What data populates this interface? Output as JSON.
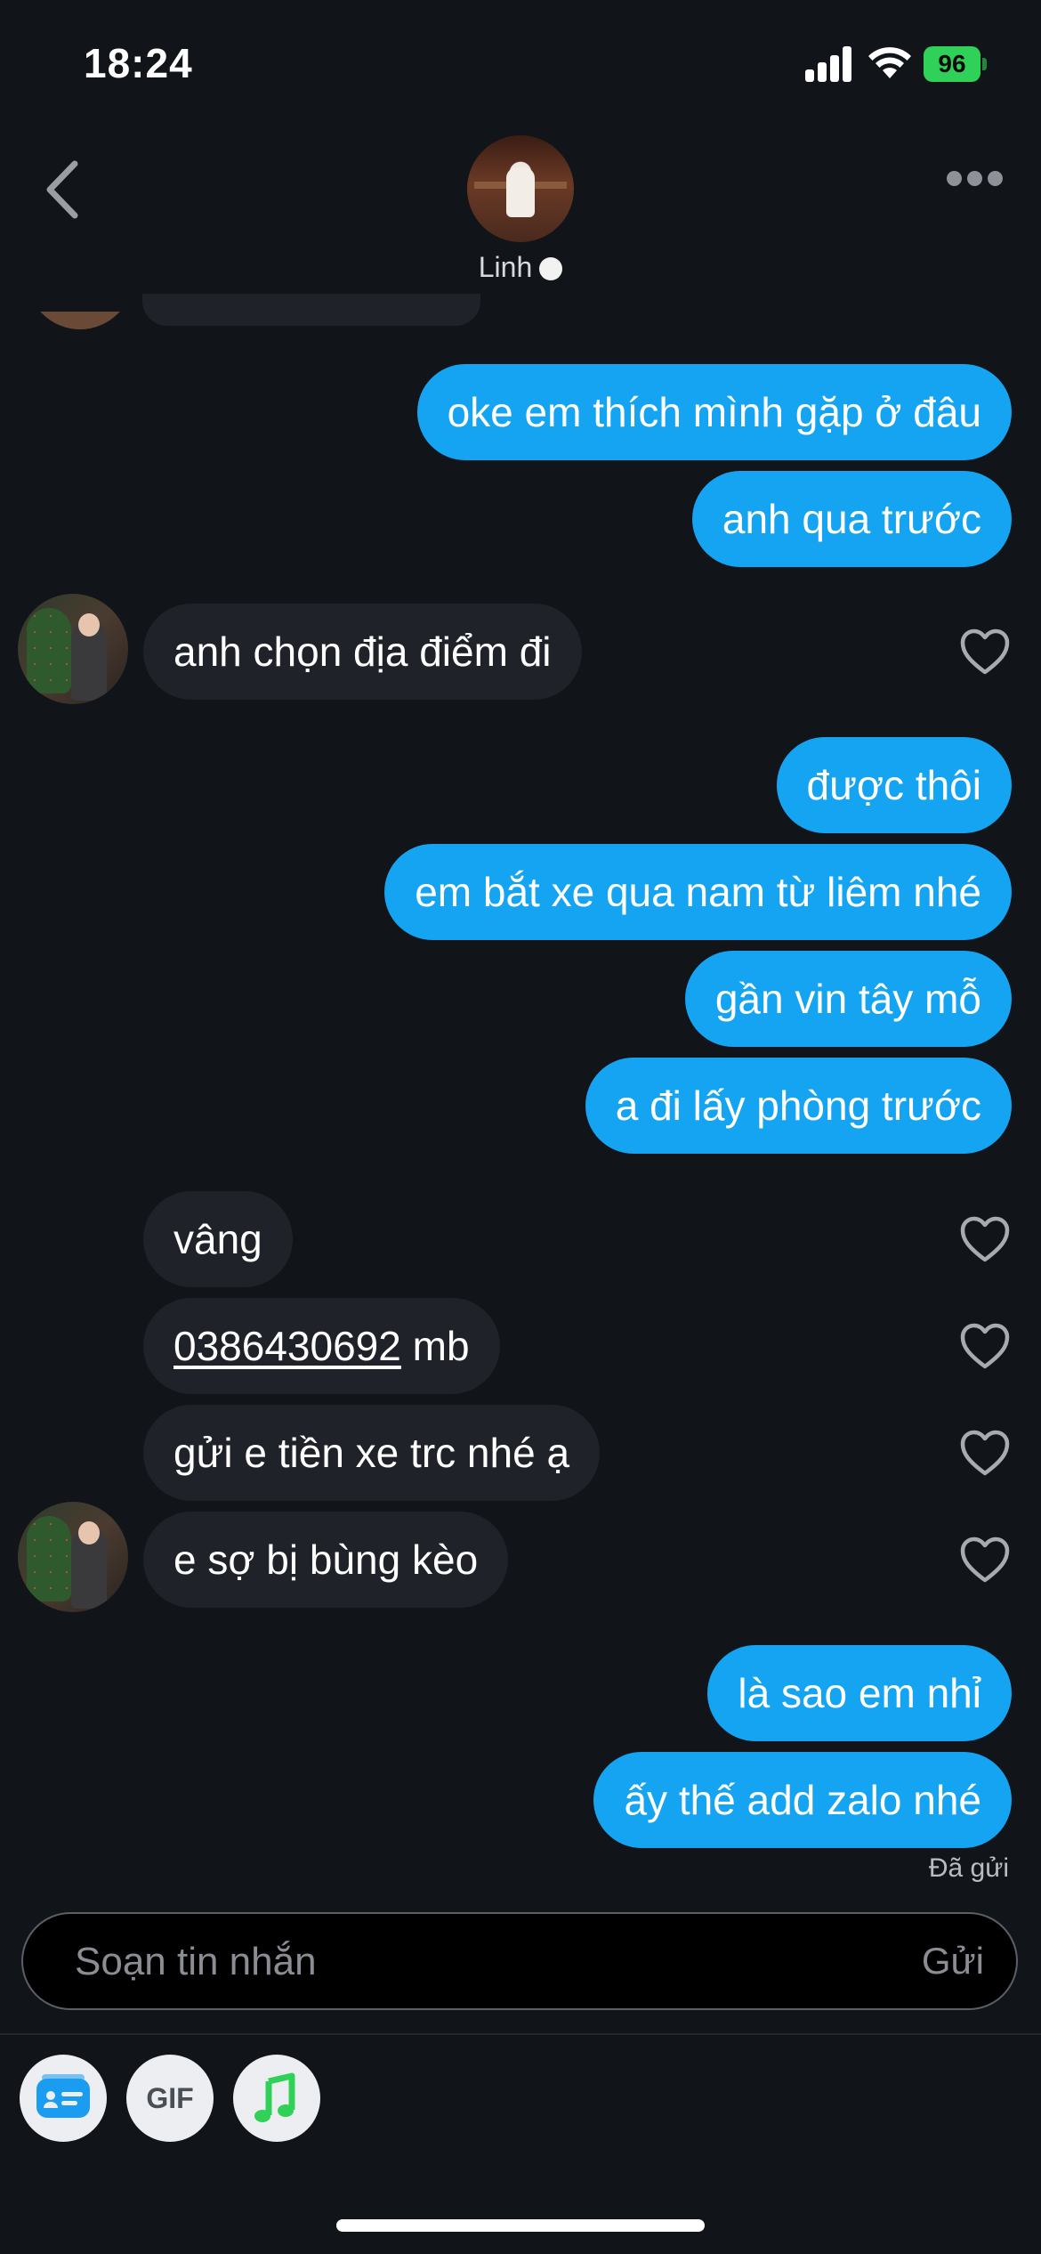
{
  "status_bar": {
    "time": "18:24",
    "battery": "96"
  },
  "header": {
    "name": "Linh"
  },
  "messages": [
    {
      "dir": "out",
      "text": "oke em thích mình gặp ở đâu"
    },
    {
      "dir": "out",
      "text": "anh qua trước"
    },
    {
      "dir": "in",
      "text": "anh chọn địa điểm đi"
    },
    {
      "dir": "out",
      "text": "được thôi"
    },
    {
      "dir": "out",
      "text": "em bắt xe qua nam từ liêm nhé"
    },
    {
      "dir": "out",
      "text": "gần vin tây mỗ"
    },
    {
      "dir": "out",
      "text": "a đi lấy phòng trước"
    },
    {
      "dir": "in",
      "text": "vâng"
    },
    {
      "dir": "in",
      "phone": "0386430692",
      "suffix": " mb"
    },
    {
      "dir": "in",
      "text": "gửi e tiền xe trc nhé ạ"
    },
    {
      "dir": "in",
      "text": "e sợ bị bùng kèo"
    },
    {
      "dir": "out",
      "text": "là sao em nhỉ"
    },
    {
      "dir": "out",
      "text": "ấy thế add zalo nhé"
    }
  ],
  "sent_status": "Đã gửi",
  "compose": {
    "placeholder": "Soạn tin nhắn",
    "send_label": "Gửi"
  },
  "toolbar": {
    "gif_label": "GIF",
    "icons": [
      "contact-card-icon",
      "gif-icon",
      "music-note-icon"
    ]
  },
  "colors": {
    "outgoing": "#15a4f2",
    "incoming": "#1f2228",
    "background": "#111418",
    "battery": "#30d158",
    "music": "#30d158"
  }
}
